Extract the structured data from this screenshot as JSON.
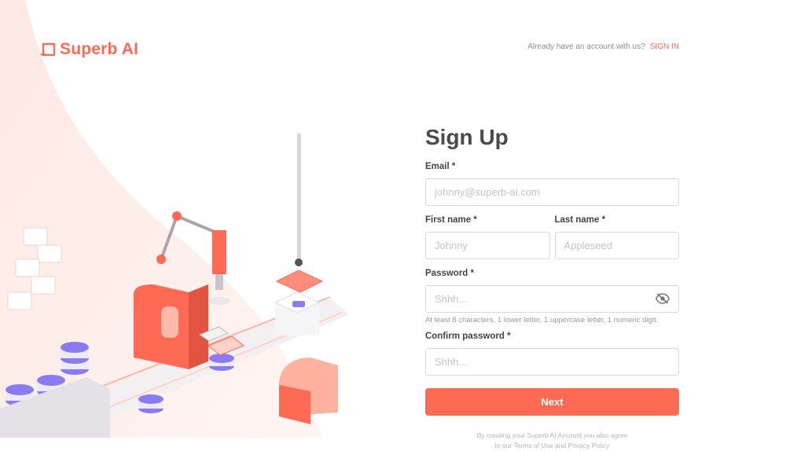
{
  "brand": {
    "name": "Superb AI",
    "color": "#ff6a55"
  },
  "header": {
    "question": "Already have an account with us?",
    "signin_label": "SIGN IN"
  },
  "form": {
    "title": "Sign Up",
    "email": {
      "label": "Email *",
      "placeholder": "johnny@superb-ai.com"
    },
    "first_name": {
      "label": "First name *",
      "placeholder": "Johnny"
    },
    "last_name": {
      "label": "Last name *",
      "placeholder": "Appleseed"
    },
    "password": {
      "label": "Password *",
      "placeholder": "Shhh...",
      "hint": "At least 8 characters, 1 lower letter, 1 uppercase letter, 1 numeric digit.",
      "toggle_icon": "eye-off-icon"
    },
    "confirm_password": {
      "label": "Confirm password *",
      "placeholder": "Shhh..."
    },
    "next_label": "Next"
  },
  "legal": {
    "line1": "By creating your Superb AI Account you also agree",
    "prefix": "to our",
    "terms": "Terms of Use",
    "and": "and",
    "privacy": "Privacy Policy"
  }
}
